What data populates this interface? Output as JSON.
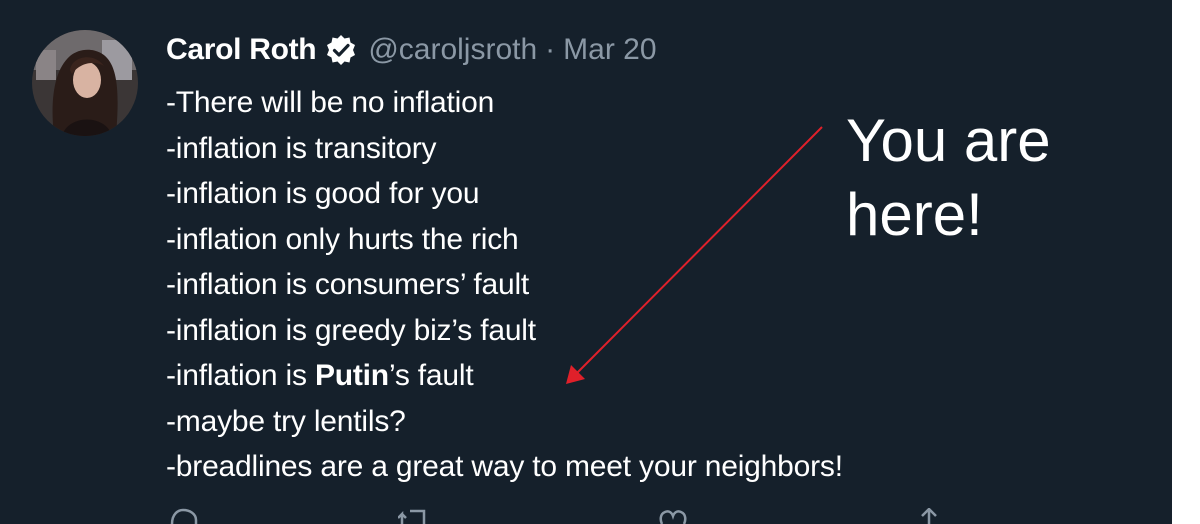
{
  "tweet": {
    "author": {
      "display_name": "Carol Roth",
      "handle": "@caroljsroth",
      "verified": true
    },
    "separator": "·",
    "date": "Mar 20",
    "lines": [
      "-There will be no inflation",
      "-inflation is transitory",
      "-inflation is good for you",
      "-inflation only hurts the rich",
      "-inflation is consumers’ fault",
      "-inflation is greedy biz’s fault",
      {
        "prefix": "-inflation is ",
        "bold": "Putin",
        "suffix": "’s fault"
      },
      "-maybe try lentils?",
      "-breadlines are a great way to meet your neighbors!"
    ],
    "actions": [
      "reply-icon",
      "retweet-icon",
      "like-icon",
      "share-icon"
    ]
  },
  "annotation": {
    "line1": "You are",
    "line2": "here!",
    "arrow_color": "#e0202a"
  },
  "colors": {
    "background": "#15202b",
    "text": "#ffffff",
    "secondary_text": "#8b98a5"
  }
}
